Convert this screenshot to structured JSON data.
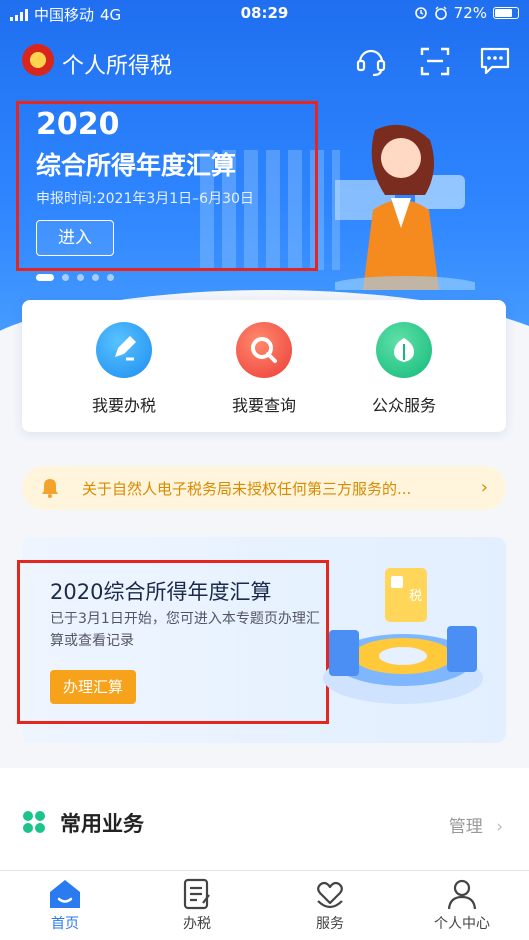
{
  "status_bar": {
    "carrier": "中国移动",
    "network": "4G",
    "time": "08:29",
    "battery": "72%"
  },
  "app": {
    "title": "个人所得税"
  },
  "header_icons": [
    "headset-icon",
    "scan-icon",
    "message-icon"
  ],
  "banner": {
    "title": "2020",
    "subtitle": "综合所得年度汇算",
    "date_text": "申报时间:2021年3月1日–6月30日",
    "enter_label": "进入",
    "page_count": 5,
    "active_page": 1
  },
  "quick_actions": [
    {
      "label": "我要办税",
      "icon": "pen-icon",
      "color": "#2a9df4"
    },
    {
      "label": "我要查询",
      "icon": "search-icon",
      "color": "#f05a4a"
    },
    {
      "label": "公众服务",
      "icon": "shield-leaf-icon",
      "color": "#1fc48a"
    }
  ],
  "notice": {
    "text": "关于自然人电子税务局未授权任何第三方服务的...",
    "arrow": "›"
  },
  "promo": {
    "title": "2020综合所得年度汇算",
    "description": "已于3月1日开始，您可进入本专题页办理汇算或查看记录",
    "button_label": "办理汇算"
  },
  "common": {
    "title": "常用业务",
    "manage_label": "管理",
    "manage_arrow": "›"
  },
  "tabs": [
    {
      "label": "首页",
      "icon": "home-icon",
      "active": true
    },
    {
      "label": "办税",
      "icon": "form-icon",
      "active": false
    },
    {
      "label": "服务",
      "icon": "heart-hand-icon",
      "active": false
    },
    {
      "label": "个人中心",
      "icon": "person-icon",
      "active": false
    }
  ],
  "colors": {
    "primary": "#2a7bf0",
    "notice_bg": "#fff5dc",
    "notice_text": "#d98a00",
    "promo_button": "#f7a21b",
    "highlight_box": "#e5261f"
  }
}
